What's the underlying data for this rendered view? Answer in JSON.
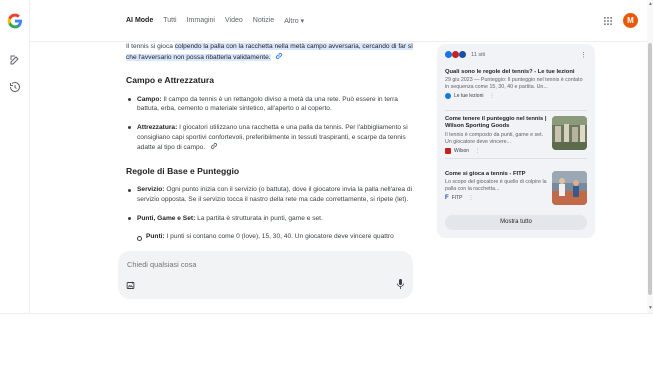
{
  "header": {
    "tabs": [
      {
        "label": "AI Mode",
        "active": true
      },
      {
        "label": "Tutti"
      },
      {
        "label": "Immagini"
      },
      {
        "label": "Video"
      },
      {
        "label": "Notizie"
      },
      {
        "label": "Altro ▾"
      }
    ],
    "avatar_letter": "M"
  },
  "answer": {
    "intro_plain": "Il tennis si gioca ",
    "intro_highlight": "colpendo la palla con la racchetta nella metà campo avversaria, cercando di far sì che l'avversario non possa ribatterla validamente.",
    "section1_title": "Campo e Attrezzatura",
    "items1": [
      {
        "label": "Campo:",
        "text": " Il campo da tennis è un rettangolo diviso a metà da una rete. Può essere in terra battuta, erba, cemento o materiale sintetico, all'aperto o al coperto."
      },
      {
        "label": "Attrezzatura:",
        "text": " I giocatori utilizzano una racchetta e una palla da tennis. Per l'abbigliamento si consigliano capi sportivi confortevoli, preferibilmente in tessuti traspiranti, e scarpe da tennis adatte al tipo di campo."
      }
    ],
    "section2_title": "Regole di Base e Punteggio",
    "items2": [
      {
        "label": "Servizio:",
        "text": " Ogni punto inizia con il servizio (o battuta), dove il giocatore invia la palla nell'area di servizio opposta. Se il servizio tocca il nastro della rete ma cade correttamente, si ripete (let)."
      },
      {
        "label": "Punti, Game e Set:",
        "text": " La partita è strutturata in punti, game e set."
      }
    ],
    "sub_item": {
      "label": "Punti:",
      "text": " I punti si contano come 0 (love), 15, 30, 40. Un giocatore deve vincere quattro"
    }
  },
  "prompt": {
    "placeholder": "Chiedi qualsiasi cosa"
  },
  "sources": {
    "count": "11 siti",
    "items": [
      {
        "title": "Quali sono le regole del tennis? - Le tue lezioni",
        "snippet": "29 giu 2023 — Punteggio: Il punteggio nel tennis è contato in sequenza come 15, 30, 40 e partita. Un...",
        "site": "Le tue lezioni"
      },
      {
        "title": "Come tenere il punteggio nel tennis | Wilson Sporting Goods",
        "snippet": "Il tennis è composto da punti, game e set. Un giocatore deve vincere...",
        "site": "Wilson"
      },
      {
        "title": "Come si gioca a tennis - FITP",
        "snippet": "Lo scopo del giocatore è quello di colpire la palla con la racchetta...",
        "site": "FITP"
      }
    ],
    "show_all": "Mostra tutto"
  },
  "colors": {
    "avatar": "#e8590c",
    "highlight": "#d9e7fd",
    "card_bg": "#f1f3f6"
  }
}
